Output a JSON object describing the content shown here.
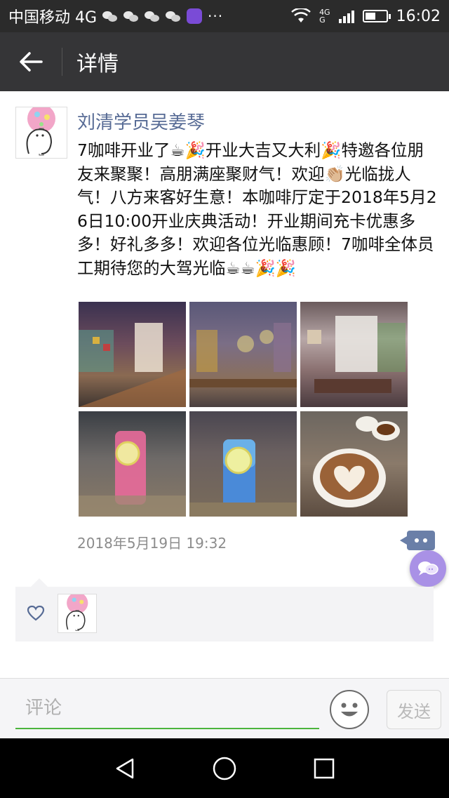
{
  "status_bar": {
    "carrier": "中国移动 4G",
    "more": "···",
    "net_type_top": "4G",
    "net_type_bottom": "G",
    "time": "16:02"
  },
  "header": {
    "title": "详情"
  },
  "post": {
    "author": "刘清学员吴姜琴",
    "text": "7咖啡开业了☕🎉开业大吉又大利🎉特邀各位朋友来聚聚！高朋满座聚财气！欢迎👏🏼光临拢人气！八方来客好生意！本咖啡厅定于2018年5月26日10:00开业庆典活动！开业期间充卡优惠多多！好礼多多！欢迎各位光临惠顾！7咖啡全体员工期待您的大驾光临☕☕🎉🎉",
    "time": "2018年5月19日 19:32",
    "photo_count": 6
  },
  "comment_bar": {
    "placeholder": "评论",
    "value": "",
    "send_label": "发送"
  },
  "colors": {
    "status_bar_bg": "#2b2b2b",
    "nav_bar_bg": "#353537",
    "author_name": "#576b95",
    "input_underline": "#4bb43c",
    "float_button": "#a991e6"
  },
  "icons": {
    "back": "arrow-left-icon",
    "comment": "comment-dots-icon",
    "like": "heart-icon",
    "emoji": "smiley-icon",
    "float": "chat-bubble-icon",
    "sys_back": "triangle-back-icon",
    "sys_home": "circle-home-icon",
    "sys_recent": "square-recent-icon"
  }
}
